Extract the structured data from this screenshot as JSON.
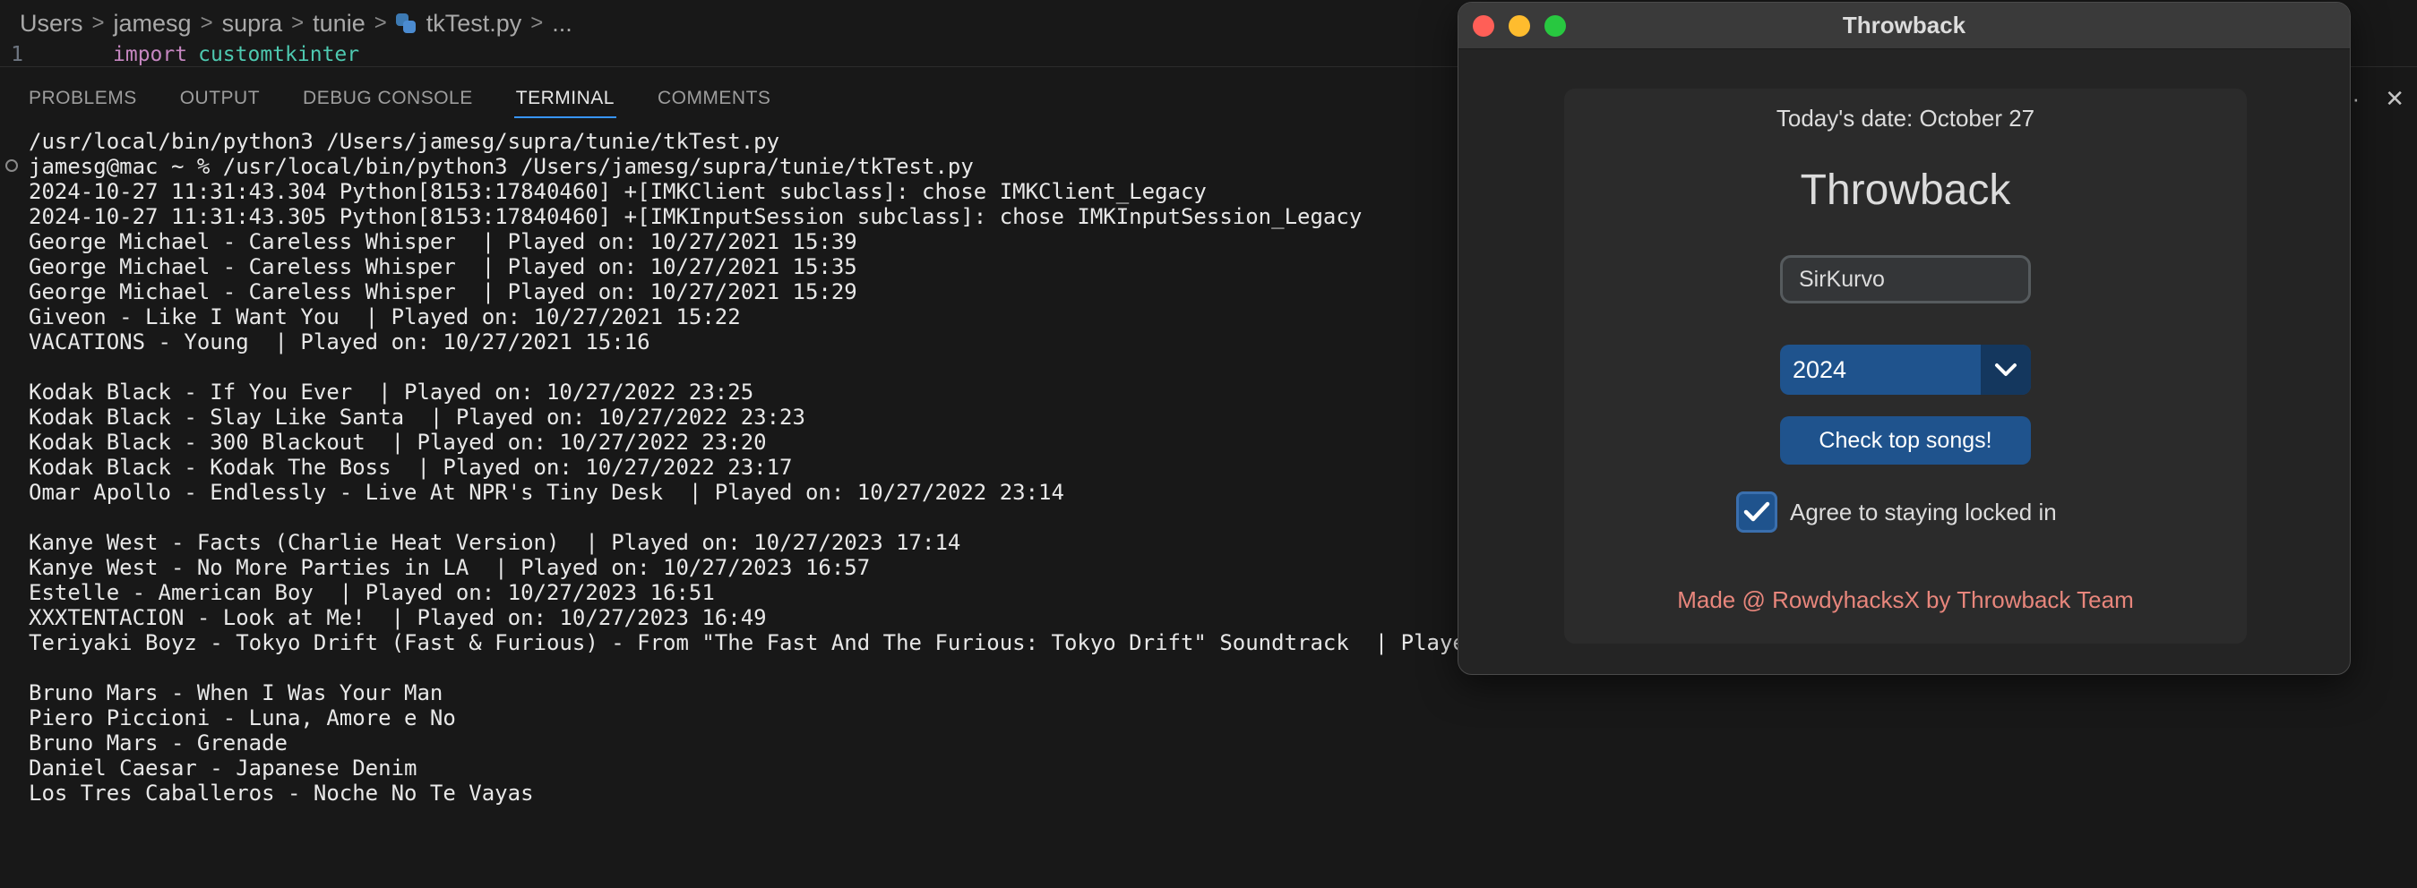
{
  "editor": {
    "breadcrumb": [
      "Users",
      "jamesg",
      "supra",
      "tunie",
      "tkTest.py",
      "..."
    ],
    "breadcrumb_sep": ">",
    "code": {
      "line_number": "1",
      "keyword": "import",
      "module": "customtkinter"
    },
    "tabs": [
      "PROBLEMS",
      "OUTPUT",
      "DEBUG CONSOLE",
      "TERMINAL",
      "COMMENTS"
    ],
    "active_tab": "TERMINAL",
    "actions": {
      "more": "···",
      "close": "✕"
    }
  },
  "terminal": {
    "lines": [
      "/usr/local/bin/python3 /Users/jamesg/supra/tunie/tkTest.py",
      "jamesg@mac ~ % /usr/local/bin/python3 /Users/jamesg/supra/tunie/tkTest.py",
      "2024-10-27 11:31:43.304 Python[8153:17840460] +[IMKClient subclass]: chose IMKClient_Legacy",
      "2024-10-27 11:31:43.305 Python[8153:17840460] +[IMKInputSession subclass]: chose IMKInputSession_Legacy",
      "George Michael - Careless Whisper  | Played on: 10/27/2021 15:39",
      "George Michael - Careless Whisper  | Played on: 10/27/2021 15:35",
      "George Michael - Careless Whisper  | Played on: 10/27/2021 15:29",
      "Giveon - Like I Want You  | Played on: 10/27/2021 15:22",
      "VACATIONS - Young  | Played on: 10/27/2021 15:16",
      "",
      "Kodak Black - If You Ever  | Played on: 10/27/2022 23:25",
      "Kodak Black - Slay Like Santa  | Played on: 10/27/2022 23:23",
      "Kodak Black - 300 Blackout  | Played on: 10/27/2022 23:20",
      "Kodak Black - Kodak The Boss  | Played on: 10/27/2022 23:17",
      "Omar Apollo - Endlessly - Live At NPR's Tiny Desk  | Played on: 10/27/2022 23:14",
      "",
      "Kanye West - Facts (Charlie Heat Version)  | Played on: 10/27/2023 17:14",
      "Kanye West - No More Parties in LA  | Played on: 10/27/2023 16:57",
      "Estelle - American Boy  | Played on: 10/27/2023 16:51",
      "XXXTENTACION - Look at Me!  | Played on: 10/27/2023 16:49",
      "Teriyaki Boyz - Tokyo Drift (Fast & Furious) - From \"The Fast And The Furious: Tokyo Drift\" Soundtrack  | Played o",
      "",
      "Bruno Mars - When I Was Your Man",
      "Piero Piccioni - Luna, Amore e No",
      "Bruno Mars - Grenade",
      "Daniel Caesar - Japanese Denim",
      "Los Tres Caballeros - Noche No Te Vayas"
    ]
  },
  "app": {
    "window_title": "Throwback",
    "date_label": "Today's date: October 27",
    "title": "Throwback",
    "username_value": "SirKurvo",
    "year_selected": "2024",
    "check_button": "Check top songs!",
    "agree_label": "Agree to staying locked in",
    "agree_checked": true,
    "credit": "Made @ RowdyhacksX by Throwback Team"
  },
  "colors": {
    "accent": "#1f538d",
    "accent_dark": "#14375e",
    "credit": "#e8867c",
    "tab_underline": "#3794ff"
  }
}
